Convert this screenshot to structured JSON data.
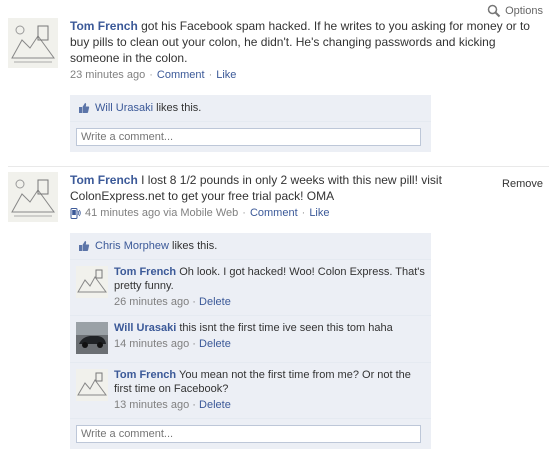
{
  "options_label": "Options",
  "stories": [
    {
      "author": "Tom French",
      "text": " got his Facebook spam hacked. If he writes to you asking for money or to buy pills to clean out your colon, he didn't. He's changing passwords and kicking someone in the colon.",
      "time": "23 minutes ago",
      "comment_link": "Comment",
      "like_link": "Like",
      "liker": "Will Urasaki",
      "likes_suffix": " likes this.",
      "write_placeholder": "Write a comment..."
    },
    {
      "author": "Tom French",
      "text": " I lost 8 1/2 pounds in only 2 weeks with this new pill! visit ColonExpress.net to get your free trial pack! OMA",
      "time": "41 minutes ago via Mobile Web",
      "comment_link": "Comment",
      "like_link": "Like",
      "remove_label": "Remove",
      "liker": "Chris Morphew",
      "likes_suffix": " likes this.",
      "comments": [
        {
          "author": "Tom French",
          "text": " Oh look. I got hacked! Woo! Colon Express. That's pretty funny.",
          "time": "26 minutes ago",
          "action": "Delete"
        },
        {
          "author": "Will Urasaki",
          "text": " this isnt the first time ive seen this tom haha",
          "time": "14 minutes ago",
          "action": "Delete"
        },
        {
          "author": "Tom French",
          "text": " You mean not the first time from me? Or not the first time on Facebook?",
          "time": "13 minutes ago",
          "action": "Delete"
        }
      ],
      "write_placeholder": "Write a comment..."
    }
  ],
  "separator": "·",
  "icons": {
    "options": "magnifier-icon",
    "like": "thumbs-up-icon",
    "mobile": "mobile-phone-icon"
  }
}
